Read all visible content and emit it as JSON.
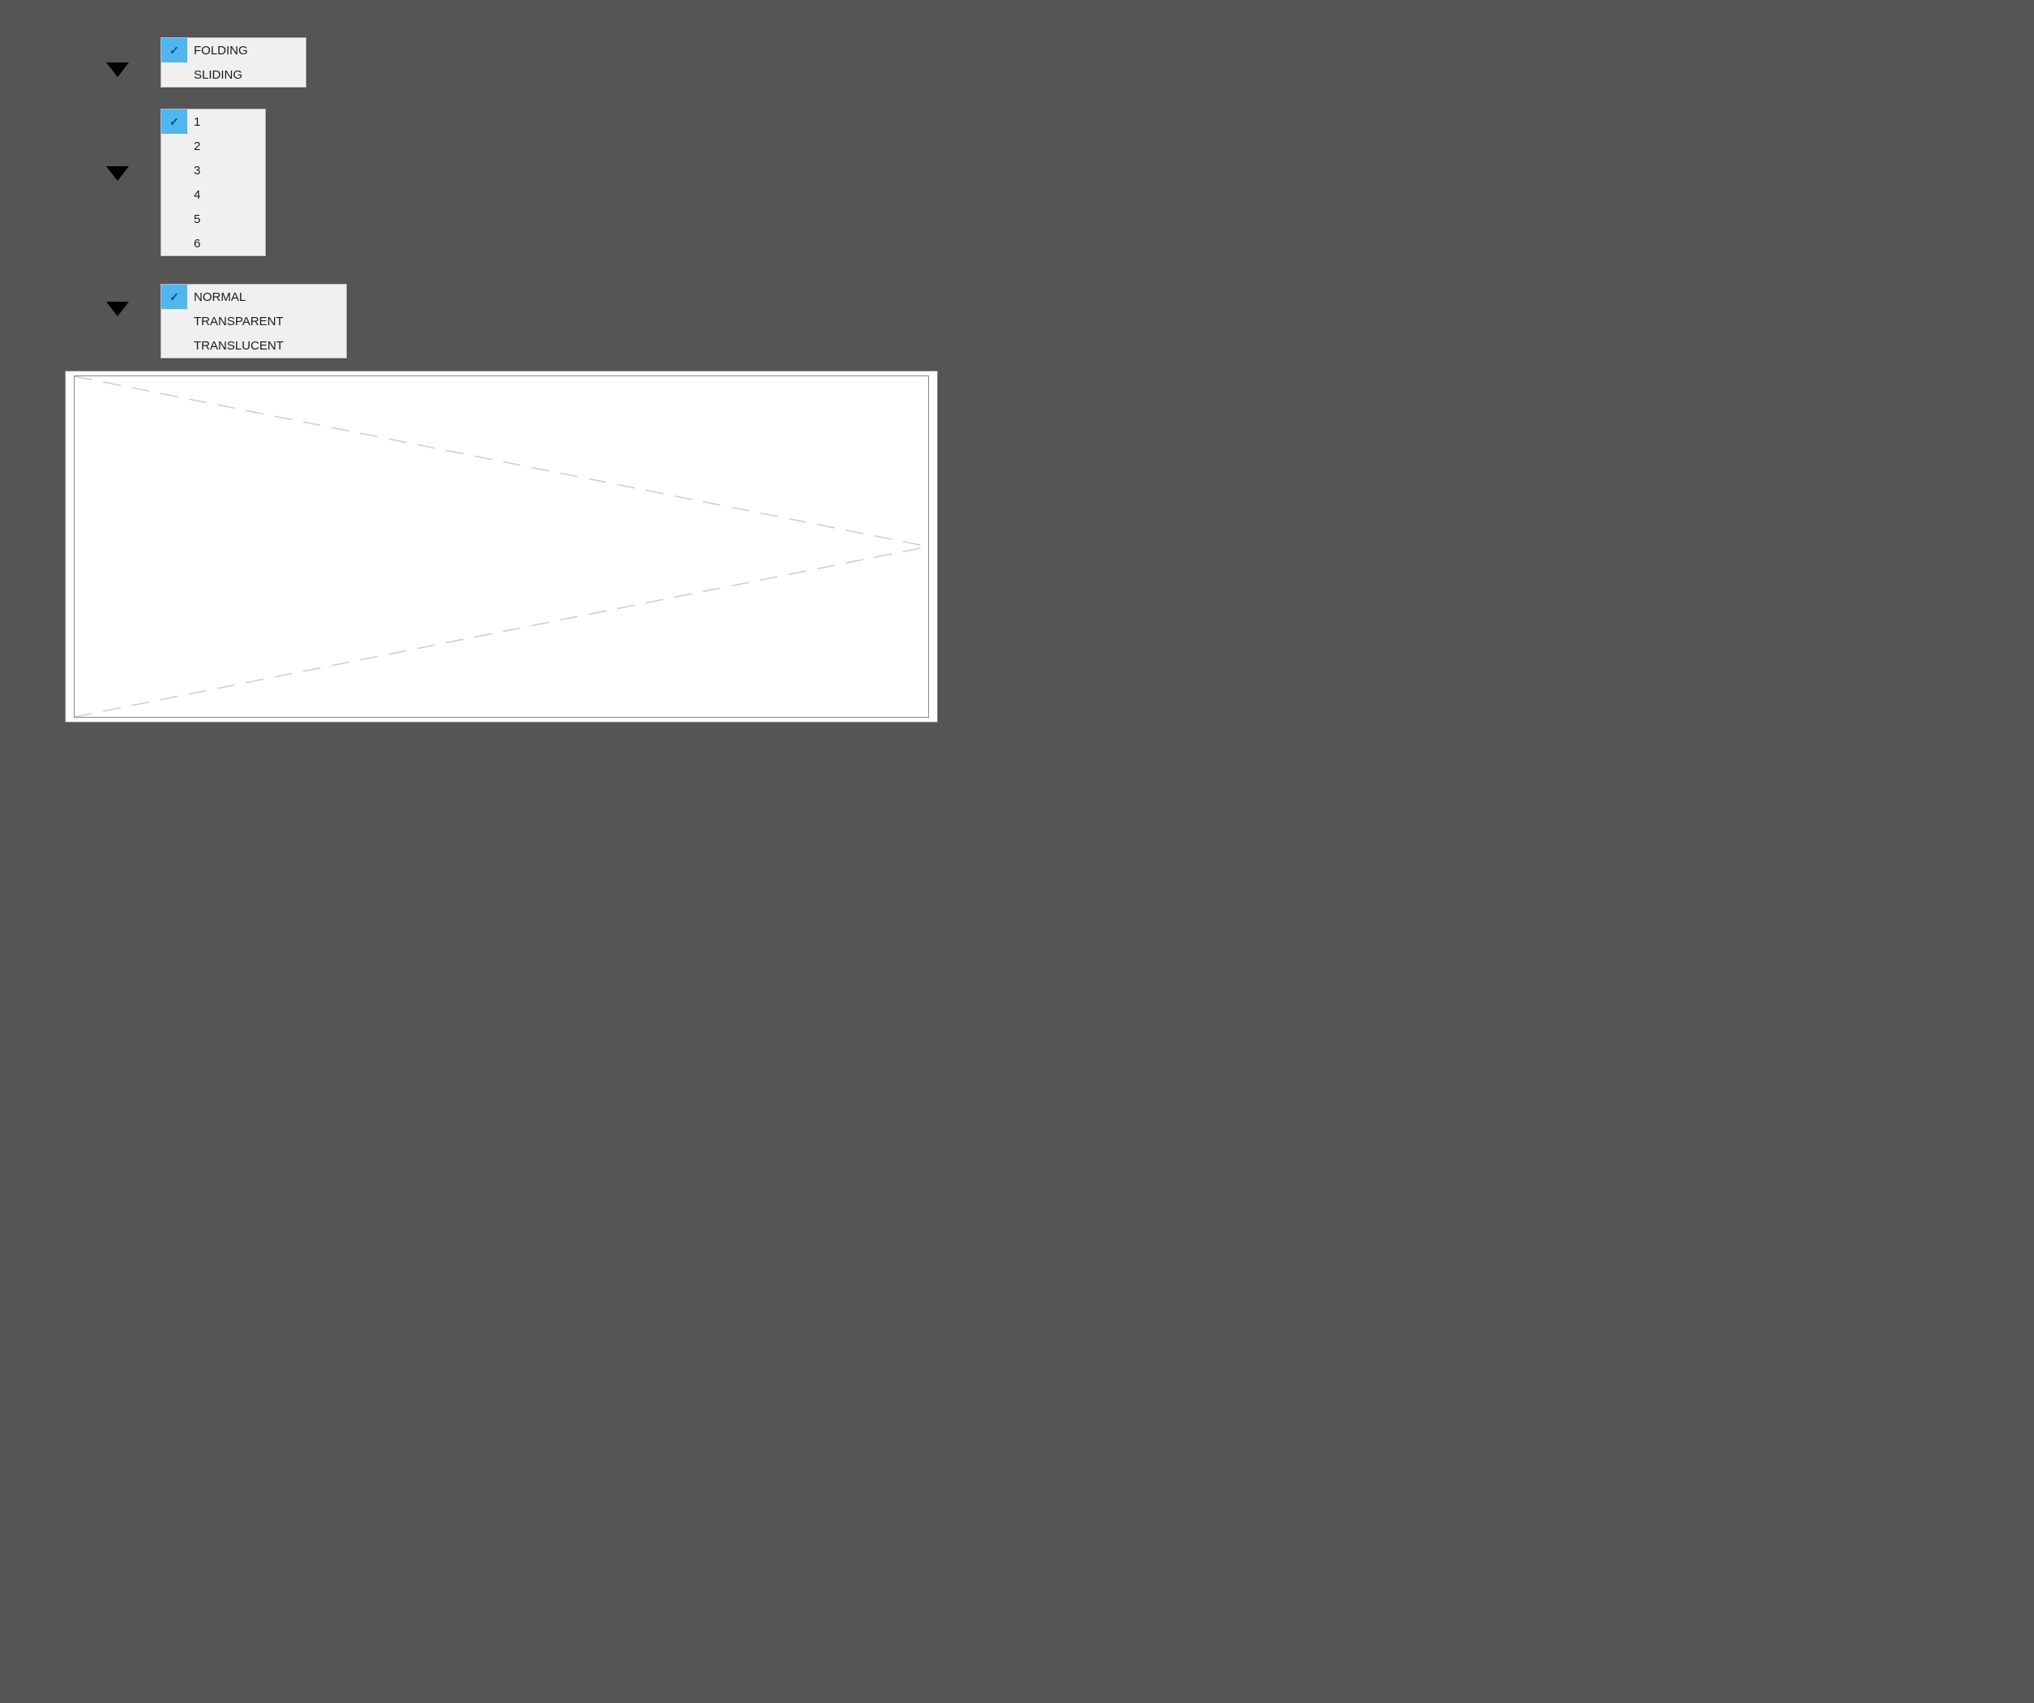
{
  "menus": {
    "doorType": {
      "items": [
        {
          "label": "FOLDING",
          "checked": true
        },
        {
          "label": "SLIDING",
          "checked": false
        }
      ]
    },
    "panelCount": {
      "items": [
        {
          "label": "1",
          "checked": true
        },
        {
          "label": "2",
          "checked": false
        },
        {
          "label": "3",
          "checked": false
        },
        {
          "label": "4",
          "checked": false
        },
        {
          "label": "5",
          "checked": false
        },
        {
          "label": "6",
          "checked": false
        }
      ]
    },
    "glassType": {
      "items": [
        {
          "label": "NORMAL",
          "checked": true
        },
        {
          "label": "TRANSPARENT",
          "checked": false
        },
        {
          "label": "TRANSLUCENT",
          "checked": false
        }
      ]
    }
  },
  "colors": {
    "checkHighlight": "#4fb6f0",
    "menuBg": "#f0f0f0"
  }
}
